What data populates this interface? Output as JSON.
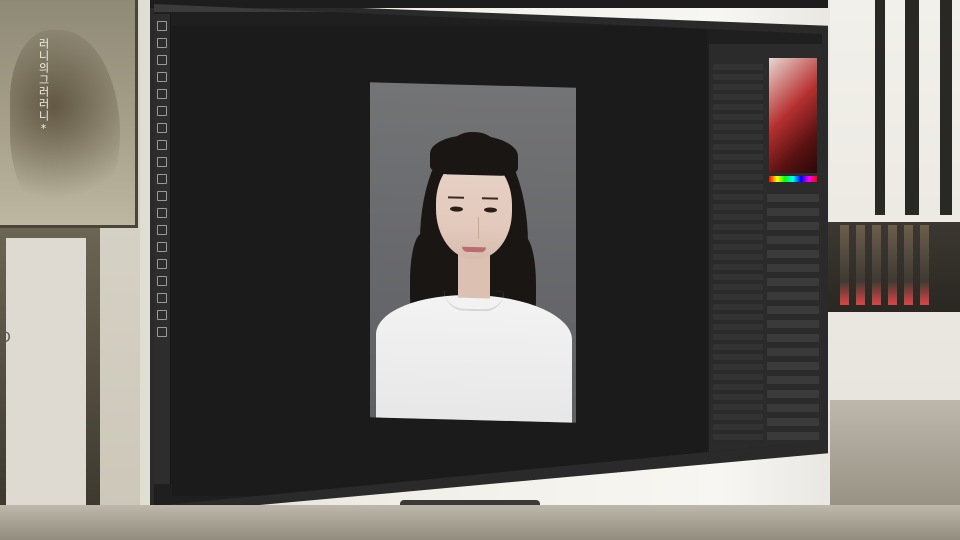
{
  "brand": {
    "text": "러니의그러러니*"
  },
  "shelf": {
    "letter": "D"
  },
  "scene": {
    "app": "photo-editor",
    "canvas_subject": "id-portrait-photo",
    "colors": {
      "canvas_bg": "#1b1b1b",
      "panel_bg": "#2b2b2b",
      "photo_bg": "#6c6d70",
      "shirt": "#f0f0f0",
      "hair": "#1a1614",
      "swatch_accent": "#b63030"
    }
  }
}
